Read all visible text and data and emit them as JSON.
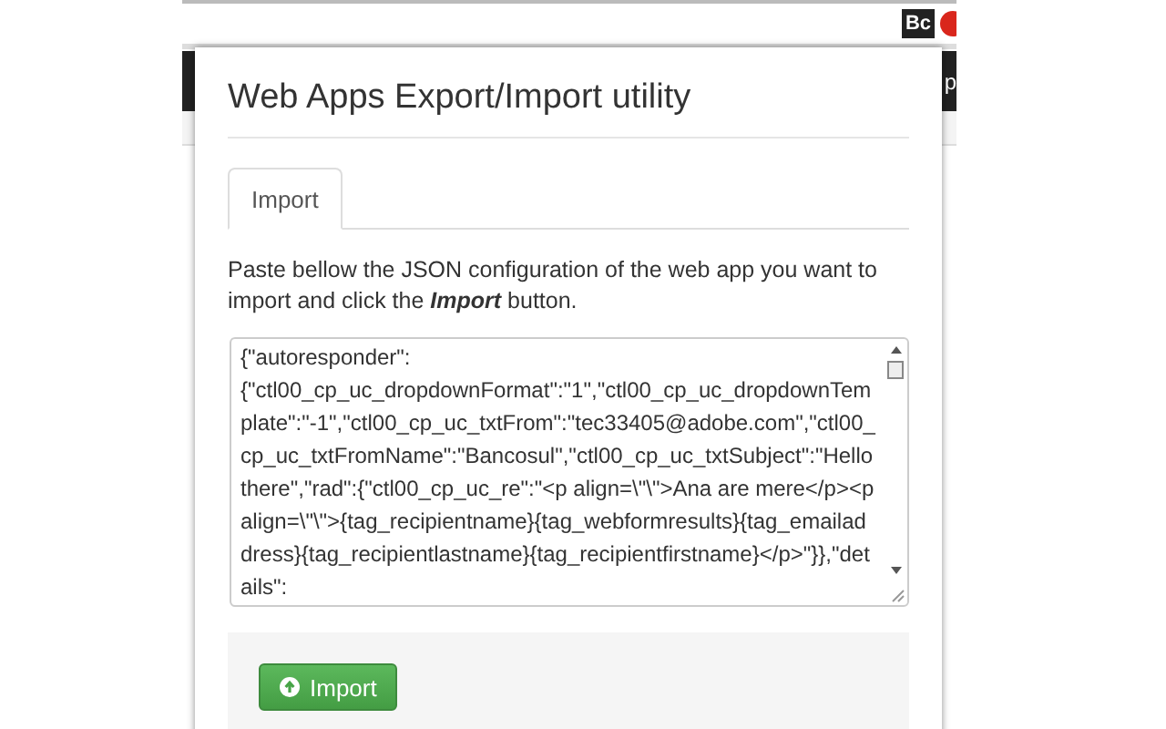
{
  "browser": {
    "extension_label": "Bc",
    "behind_text": "p"
  },
  "popup": {
    "title": "Web Apps Export/Import utility",
    "tabs": [
      {
        "label": "Import",
        "selected": true
      }
    ],
    "instructions": "Paste bellow the JSON configuration of the web app you want to import and click the **Import** button.",
    "json_value": "{\"autoresponder\":\n{\"ctl00_cp_uc_dropdownFormat\":\"1\",\"ctl00_cp_uc_dropdownTemplate\":\"-1\",\"ctl00_cp_uc_txtFrom\":\"tec33405@adobe.com\",\"ctl00_cp_uc_txtFromName\":\"Bancosul\",\"ctl00_cp_uc_txtSubject\":\"Hello there\",\"rad\":{\"ctl00_cp_uc_re\":\"<p align=\\\"\\\">Ana are mere</p><p align=\\\"\\\">{tag_recipientname}{tag_webformresults}{tag_emailaddress}{tag_recipientlastname}{tag_recipientfirstname}</p>\"}},\"details\":",
    "button": "Import"
  }
}
